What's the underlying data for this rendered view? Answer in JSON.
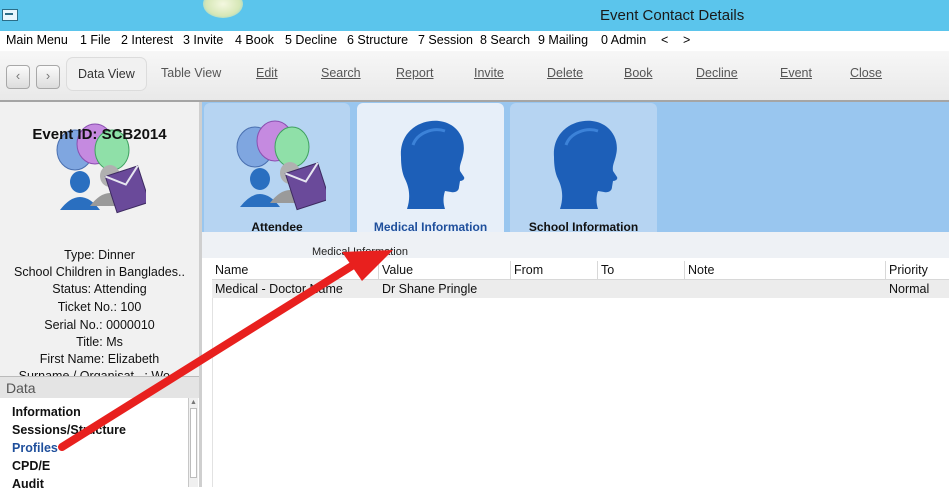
{
  "window": {
    "title": "Event Contact Details"
  },
  "menu": {
    "items": [
      "Main Menu",
      "1 File",
      "2 Interest",
      "3 Invite",
      "4 Book",
      "5 Decline",
      "6 Structure",
      "7 Session",
      "8 Search",
      "9 Mailing",
      "0 Admin",
      "<",
      ">"
    ]
  },
  "toolbar": {
    "back_icon": "chevron-left-icon",
    "forward_icon": "chevron-right-icon",
    "buttons": [
      "Data View",
      "Table View",
      "Edit",
      "Search",
      "Report",
      "Invite",
      "Delete",
      "Book",
      "Decline",
      "Event",
      "Close"
    ]
  },
  "event": {
    "id_label": "Event ID: SCB2014",
    "type": "Type: Dinner",
    "name": "School Children in Banglades..",
    "status": "Status: Attending",
    "ticket": "Ticket No.: 100",
    "serial": "Serial No.: 0000010",
    "title": "Title: Ms",
    "first_name": "First Name: Elizabeth",
    "surname": "Surname / Organisat...: Wo..."
  },
  "data_panel": {
    "header": "Data",
    "items": [
      "Information",
      "Sessions/Structure",
      "Profiles",
      "CPD/E",
      "Audit"
    ],
    "active": "Profiles"
  },
  "tabs": {
    "items": [
      "Attendee",
      "Medical Information",
      "School Information"
    ],
    "active": "Medical Information"
  },
  "section": {
    "label": "Medical Information"
  },
  "table": {
    "columns": [
      "Name",
      "Value",
      "From",
      "To",
      "Note",
      "Priority"
    ],
    "rows": [
      [
        "Medical - Doctor Name",
        "Dr Shane Pringle",
        "",
        "",
        "",
        "Normal"
      ]
    ]
  },
  "colors": {
    "titlebar": "#5bc5ec",
    "tabstrip": "#99c6ef",
    "active_text": "#1f4f9c",
    "annotation_arrow": "#e8201e"
  }
}
